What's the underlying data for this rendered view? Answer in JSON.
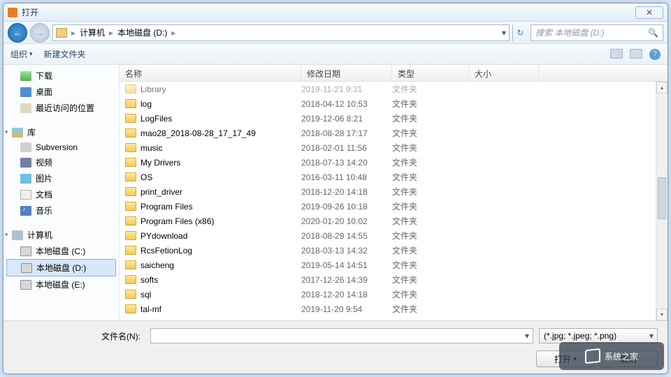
{
  "window": {
    "title": "打开",
    "close_label": "✕"
  },
  "nav": {
    "breadcrumb": [
      "计算机",
      "本地磁盘 (D:)"
    ],
    "search_placeholder": "搜索 本地磁盘 (D:)"
  },
  "toolbar": {
    "organize": "组织",
    "new_folder": "新建文件夹"
  },
  "sidebar": {
    "favorites": [
      {
        "label": "下载",
        "icon": "dl"
      },
      {
        "label": "桌面",
        "icon": "desktop"
      },
      {
        "label": "最近访问的位置",
        "icon": "recent"
      }
    ],
    "libraries_label": "库",
    "libraries": [
      {
        "label": "Subversion",
        "icon": "svn"
      },
      {
        "label": "视频",
        "icon": "video"
      },
      {
        "label": "图片",
        "icon": "pic"
      },
      {
        "label": "文档",
        "icon": "doc"
      },
      {
        "label": "音乐",
        "icon": "music"
      }
    ],
    "computer_label": "计算机",
    "drives": [
      {
        "label": "本地磁盘 (C:)"
      },
      {
        "label": "本地磁盘 (D:)",
        "selected": true
      },
      {
        "label": "本地磁盘 (E:)"
      }
    ]
  },
  "columns": {
    "name": "名称",
    "date": "修改日期",
    "type": "类型",
    "size": "大小"
  },
  "type_folder": "文件夹",
  "files": [
    {
      "name": "Library",
      "date": "2019-11-21 9:31",
      "faded": true
    },
    {
      "name": "log",
      "date": "2018-04-12 10:53"
    },
    {
      "name": "LogFiles",
      "date": "2019-12-06 8:21"
    },
    {
      "name": "mao28_2018-08-28_17_17_49",
      "date": "2018-08-28 17:17"
    },
    {
      "name": "music",
      "date": "2018-02-01 11:56"
    },
    {
      "name": "My Drivers",
      "date": "2018-07-13 14:20"
    },
    {
      "name": "OS",
      "date": "2016-03-11 10:48"
    },
    {
      "name": "print_driver",
      "date": "2018-12-20 14:18"
    },
    {
      "name": "Program Files",
      "date": "2019-09-26 10:18"
    },
    {
      "name": "Program Files (x86)",
      "date": "2020-01-20 10:02"
    },
    {
      "name": "PYdownload",
      "date": "2018-08-29 14:55"
    },
    {
      "name": "RcsFetionLog",
      "date": "2018-03-13 14:32"
    },
    {
      "name": "saicheng",
      "date": "2019-05-14 14:51"
    },
    {
      "name": "softs",
      "date": "2017-12-26 14:39"
    },
    {
      "name": "sql",
      "date": "2018-12-20 14:18"
    },
    {
      "name": "tal-mf",
      "date": "2019-11-20 9:54"
    }
  ],
  "footer": {
    "filename_label": "文件名(N):",
    "filter": "(*.jpg; *.jpeg; *.png)",
    "open": "打开",
    "cancel": "取消"
  },
  "watermark": "系统之家"
}
